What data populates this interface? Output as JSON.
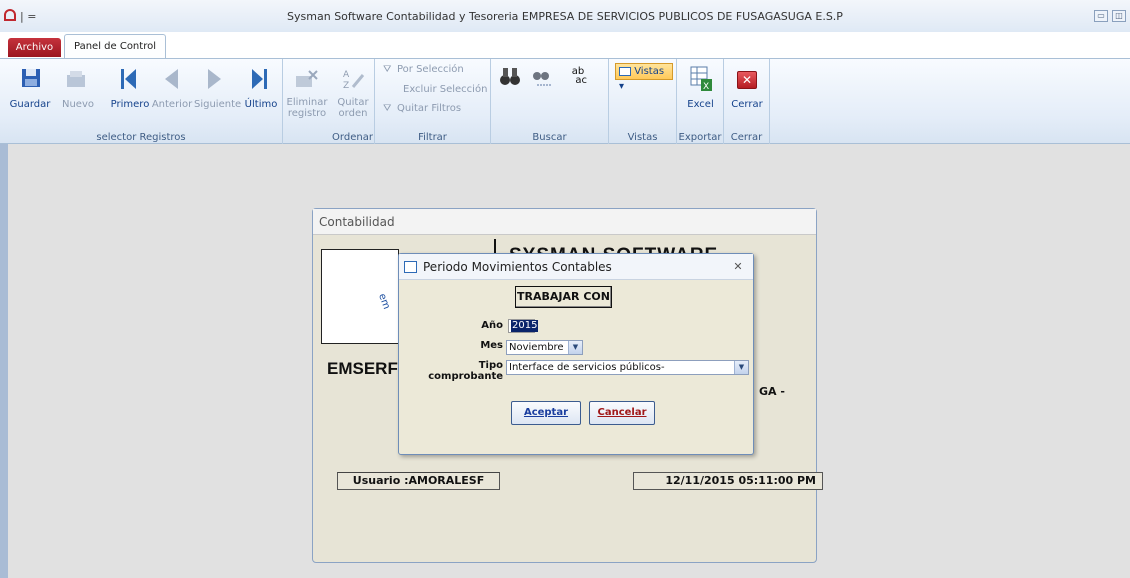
{
  "window": {
    "title": "Sysman Software Contabilidad y Tesoreria EMPRESA DE SERVICIOS PUBLICOS DE FUSAGASUGA E.S.P",
    "qat": "|  ="
  },
  "tabs": {
    "archivo": "Archivo",
    "panel": "Panel de Control"
  },
  "ribbon": {
    "guardar": "Guardar",
    "nuevo": "Nuevo",
    "primero": "Primero",
    "anterior": "Anterior",
    "siguiente": "Siguiente",
    "ultimo": "Último",
    "eliminar1": "Eliminar",
    "eliminar2": "registro",
    "quitar1": "Quitar",
    "quitar2": "orden",
    "por_seleccion": "Por Selección",
    "excluir": "Excluir Selección",
    "quitar_filtros": "Quitar Filtros",
    "vistas_btn": "Vistas",
    "excel": "Excel",
    "cerrar": "Cerrar",
    "groups": {
      "selector": "selector Registros",
      "ordenar": "Ordenar",
      "filtrar": "Filtrar",
      "buscar": "Buscar",
      "vistas": "Vistas",
      "exportar": "Exportar",
      "cerrar": "Cerrar"
    }
  },
  "main_form": {
    "caption": "Contabilidad",
    "company": "EMSERF",
    "header": "SYSMAN SOFTWARE",
    "partial": "GA -",
    "usuario": "Usuario  :AMORALESF",
    "datetime": "12/11/2015 05:11:00 PM"
  },
  "dialog": {
    "title": "Periodo Movimientos Contables",
    "close": "✕",
    "trabajar": "TRABAJAR CON",
    "anio_label": "Año",
    "anio": "2015",
    "mes_label": "Mes",
    "mes": "Noviembre",
    "tipo_label": "Tipo comprobante",
    "tipo": "Interface de servicios públicos-",
    "aceptar": "Aceptar",
    "cancelar": "Cancelar"
  }
}
